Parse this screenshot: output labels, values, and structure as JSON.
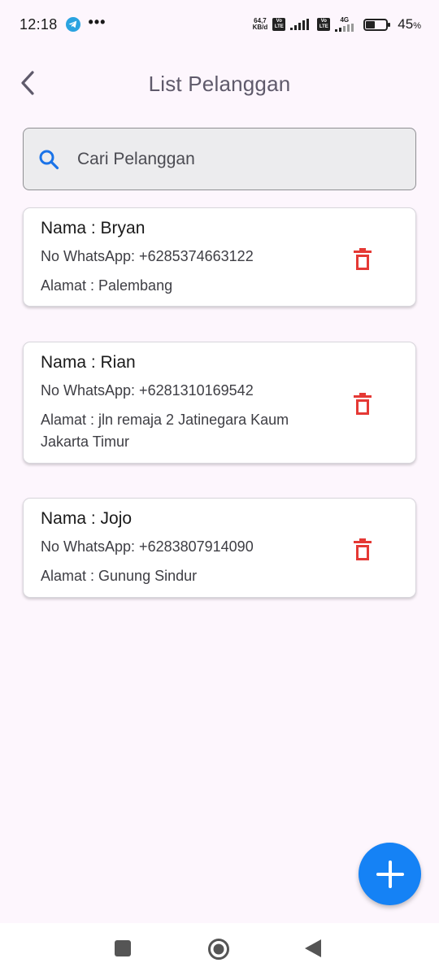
{
  "status_bar": {
    "time": "12:18",
    "more": "•••",
    "net_speed_value": "64,7",
    "net_speed_unit": "KB/d",
    "sim1_badge": "Vo LTE",
    "sim2_badge": "Vo LTE",
    "sim2_network": "4G",
    "battery_percent": "45",
    "battery_unit": "%",
    "battery_level": 0.45
  },
  "app_bar": {
    "title": "List Pelanggan",
    "back_icon": "chevron-left-icon"
  },
  "search": {
    "placeholder": "Cari Pelanggan",
    "value": "",
    "icon": "search-icon"
  },
  "customers": [
    {
      "name": "Nama : Bryan",
      "phone": "No WhatsApp: +6285374663122",
      "address": "Alamat : Palembang"
    },
    {
      "name": "Nama : Rian",
      "phone": "No WhatsApp: +6281310169542",
      "address": "Alamat : jln remaja 2 Jatinegara Kaum Jakarta Timur"
    },
    {
      "name": "Nama : Jojo",
      "phone": "No WhatsApp: +6283807914090",
      "address": "Alamat : Gunung Sindur"
    }
  ],
  "fab": {
    "icon": "plus-icon"
  },
  "nav_bar": {
    "recent_icon": "square-icon",
    "home_icon": "circle-icon",
    "back_icon": "triangle-back-icon"
  },
  "colors": {
    "background": "#fdf6fd",
    "accent": "#1582f5",
    "delete": "#e53935",
    "title": "#5f5a6b"
  }
}
